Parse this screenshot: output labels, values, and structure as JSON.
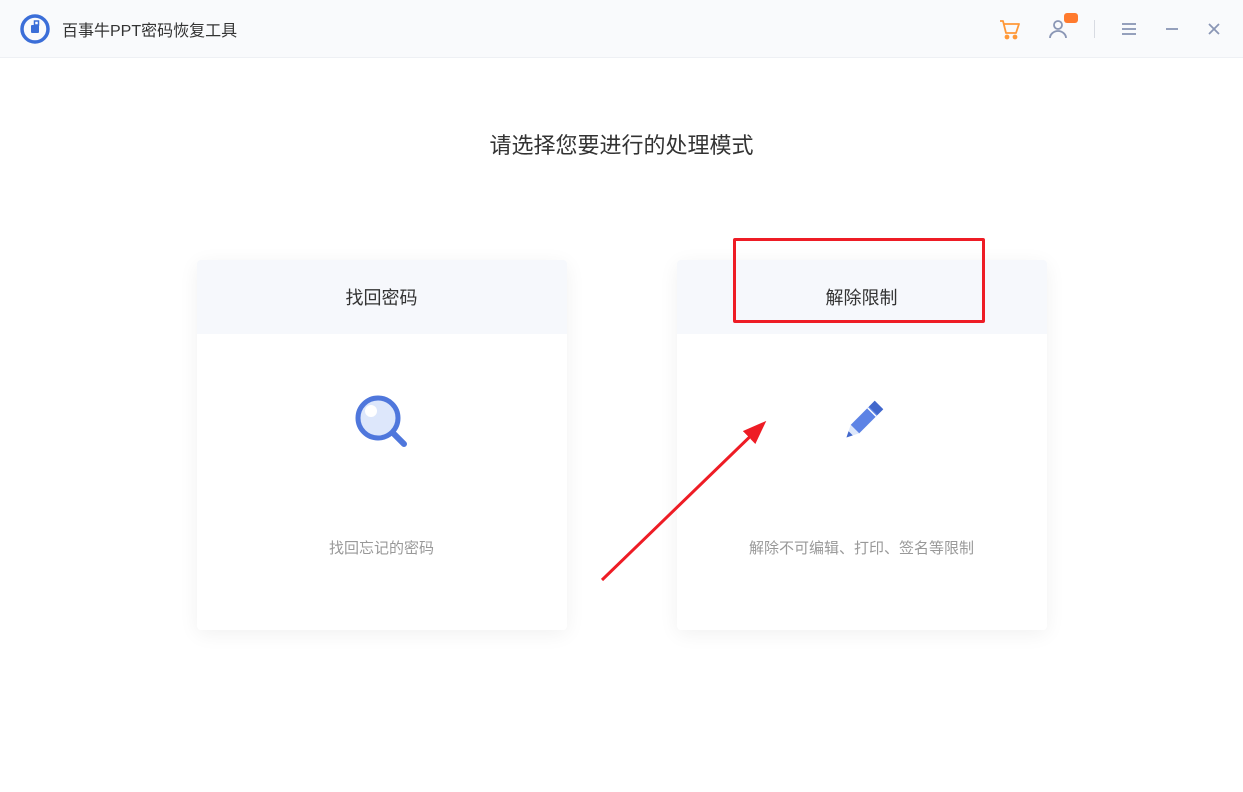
{
  "app": {
    "title": "百事牛PPT密码恢复工具"
  },
  "main": {
    "heading": "请选择您要进行的处理模式"
  },
  "cards": {
    "recover": {
      "title": "找回密码",
      "desc": "找回忘记的密码"
    },
    "remove": {
      "title": "解除限制",
      "desc": "解除不可编辑、打印、签名等限制"
    }
  }
}
